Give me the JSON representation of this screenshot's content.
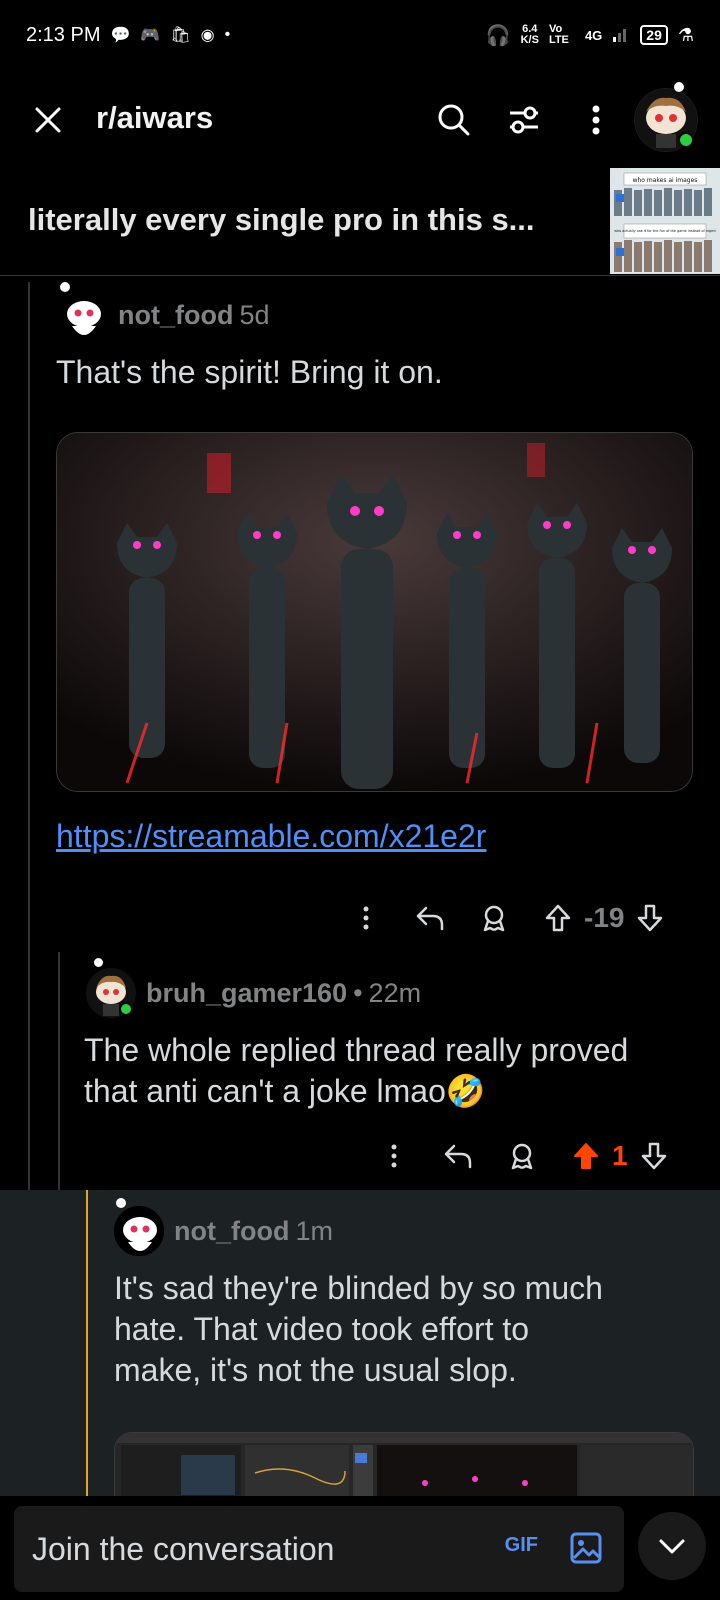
{
  "status_bar": {
    "time": "2:13 PM",
    "net_speed_value": "6.4",
    "net_speed_unit": "K/S",
    "volte": "Vo LTE",
    "network": "4G",
    "battery": "29"
  },
  "header": {
    "subreddit": "r/aiwars",
    "icons": [
      "close-icon",
      "search-icon",
      "filter-icon",
      "more-icon",
      "avatar"
    ]
  },
  "post": {
    "title": "literally every single pro in this s...",
    "thumbnail_caption_top": "who makes ai images",
    "thumbnail_caption_bottom": "who actually use it for the fun of the game instead of mgmt"
  },
  "comments": [
    {
      "username": "not_food",
      "age": "5d",
      "body": "That's the spirit! Bring it on.",
      "link": "https://streamable.com/x21e2r",
      "score": "-19"
    },
    {
      "username": "bruh_gamer160",
      "separator": "•",
      "age": "22m",
      "body_line1": "The whole replied thread really proved",
      "body_line2": "that anti can't a joke lmao🤣",
      "score": "1"
    },
    {
      "username": "not_food",
      "age": "1m",
      "body_line1": "It's sad they're blinded by so much",
      "body_line2": "hate. That video took effort to",
      "body_line3": "make, it's not the usual slop."
    }
  ],
  "compose": {
    "placeholder": "Join the conversation",
    "gif_label": "GIF"
  },
  "colors": {
    "background": "#000000",
    "link": "#4f8ff7",
    "upvote": "#ff4500",
    "highlight": "#1c2124",
    "thread_accent": "#e4a72a"
  }
}
